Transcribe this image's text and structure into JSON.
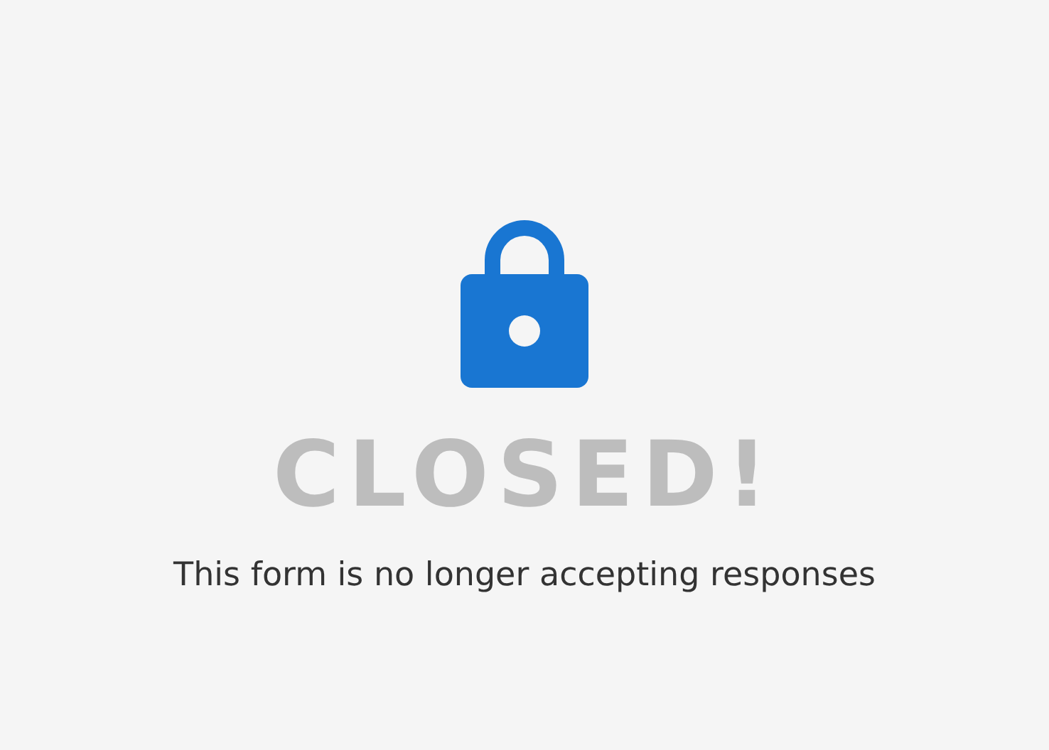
{
  "status": {
    "title": "CLOSED!",
    "message": "This form is no longer accepting responses"
  }
}
